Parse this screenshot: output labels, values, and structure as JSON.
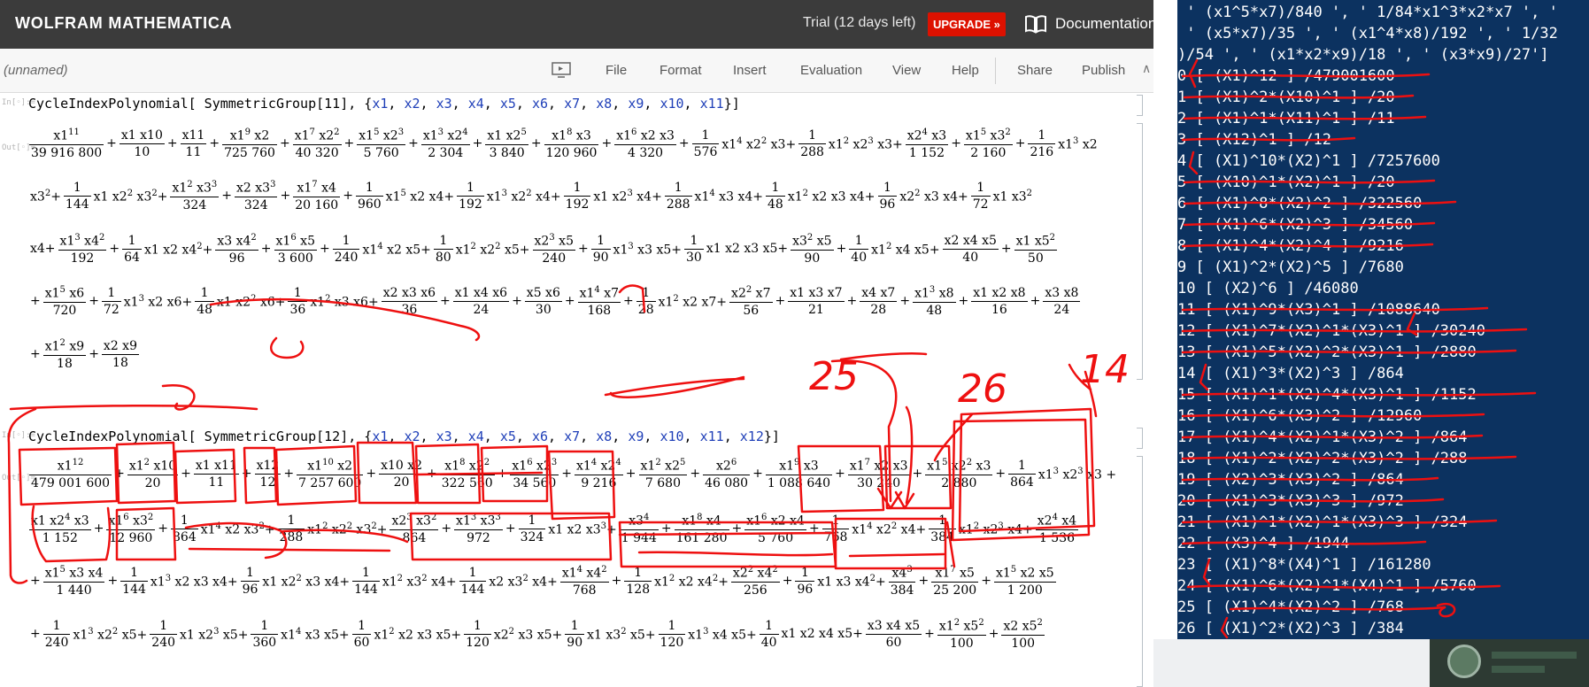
{
  "app": {
    "brand": "WOLFRAM MATHEMATICA",
    "trial": "Trial (12 days left)",
    "upgrade": "UPGRADE »",
    "documentation": "Documentation",
    "notebook_name": "(unnamed)",
    "menus": [
      "File",
      "Format",
      "Insert",
      "Evaluation",
      "View",
      "Help",
      "Share",
      "Publish"
    ],
    "cell_marker_in": "In[◦]:=",
    "cell_marker_out": "Out[◦]="
  },
  "cells": [
    {
      "input": {
        "head": "CycleIndexPolynomial[ SymmetricGroup[11], {",
        "vars": [
          "x1",
          "x2",
          "x3",
          "x4",
          "x5",
          "x6",
          "x7",
          "x8",
          "x9",
          "x10",
          "x11"
        ],
        "tail": "}]"
      },
      "lines": [
        "[x1^11|39 916 800]+[x1 x10|10]+[x11|11]+[x1^9 x2|725 760]+[x1^7 x2^2|40 320]+[x1^5 x2^3|5 760]+[x1^3 x2^4|2 304]+[x1 x2^5|3 840]+[x1^8 x3|120 960]+[x1^6 x2 x3|4 320]+[1|576] x1^4 x2^2 x3+[1|288] x1^2 x2^3 x3+[x2^4 x3|1 152]+[x1^5 x3^2|2 160]+[1|216] x1^3 x2",
        "x3^2+[1|144] x1 x2^2 x3^2+[x1^2 x3^3|324]+[x2 x3^3|324]+[x1^7 x4|20 160]+[1|960] x1^5 x2 x4+[1|192] x1^3 x2^2 x4+[1|192] x1 x2^3 x4+[1|288] x1^4 x3 x4+[1|48] x1^2 x2 x3 x4+[1|96] x2^2 x3 x4+[1|72] x1 x3^2",
        "x4+[x1^3 x4^2|192]+[1|64] x1 x2 x4^2+[x3 x4^2|96]+[x1^6 x5|3 600]+[1|240] x1^4 x2 x5+[1|80] x1^2 x2^2 x5+[x2^3 x5|240]+[1|90] x1^3 x3 x5+[1|30] x1 x2 x3 x5+[x3^2 x5|90]+[1|40] x1^2 x4 x5+[x2 x4 x5|40]+[x1 x5^2|50]",
        "+[x1^5 x6|720]+[1|72] x1^3 x2 x6+[1|48] x1 x2^2 x6+[1|36] x1^2 x3 x6+[x2 x3 x6|36]+[x1 x4 x6|24]+[x5 x6|30]+[x1^4 x7|168]+[1|28] x1^2 x2 x7+[x2^2 x7|56]+[x1 x3 x7|21]+[x4 x7|28]+[x1^3 x8|48]+[x1 x2 x8|16]+[x3 x8|24]",
        "+[x1^2 x9|18]+[x2 x9|18]"
      ]
    },
    {
      "input": {
        "head": "CycleIndexPolynomial[ SymmetricGroup[12], {",
        "vars": [
          "x1",
          "x2",
          "x3",
          "x4",
          "x5",
          "x6",
          "x7",
          "x8",
          "x9",
          "x10",
          "x11",
          "x12"
        ],
        "tail": "}]"
      },
      "lines": [
        "[x1^12|479 001 600]+[x1^2 x10|20]+[x1 x11|11]+[x12|12]+[x1^10 x2|7 257 600]+[x10 x2|20]+[x1^8 x2^2|322 560]+[x1^6 x2^3|34 560]+[x1^4 x2^4|9 216]+[x1^2 x2^5|7 680]+[x2^6|46 080]+[x1^9 x3|1 088 640]+[x1^7 x2 x3|30 240]+[x1^5 x2^2 x3|2 880]+[1|864] x1^3 x2^3 x3 +",
        "[x1 x2^4 x3|1 152]+[x1^6 x3^2|12 960]+[1|864] x1^4 x2 x3^2+[1|288] x1^2 x2^2 x3^2+[x2^3 x3^2|864]+[x1^3 x3^3|972]+[1|324] x1 x2 x3^3+[x3^4|1 944]+[x1^8 x4|161 280]+[x1^6 x2 x4|5 760]+[1|768] x1^4 x2^2 x4+[1|384] x1^2 x2^3 x4+[x2^4 x4|1 536]",
        "+[x1^5 x3 x4|1 440]+[1|144] x1^3 x2 x3 x4+[1|96] x1 x2^2 x3 x4+[1|144] x1^2 x3^2 x4+[1|144] x2 x3^2 x4+[x1^4 x4^2|768]+[1|128] x1^2 x2 x4^2+[x2^2 x4^2|256]+[1|96] x1 x3 x4^2+[x4^3|384]+[x1^7 x5|25 200]+[x1^5 x2 x5|1 200]",
        "+[1|240] x1^3 x2^2 x5+[1|240] x1 x2^3 x5+[1|360] x1^4 x3 x5+[1|60] x1^2 x2 x3 x5+[1|120] x2^2 x3 x5+[1|90] x1 x3^2 x5+[1|120] x1^3 x4 x5+[1|40] x1 x2 x4 x5+[x3 x4 x5|60]+[x1^2 x5^2|100]+[x2 x5^2|100]"
      ]
    }
  ],
  "terminal": {
    "header": [
      " ' (x1^5*x7)/840 ', ' 1/84*x1^3*x2*x7 ', '",
      " ' (x5*x7)/35 ', ' (x1^4*x8)/192 ', ' 1/32",
      ")/54 ', ' (x1*x2*x9)/18 ', ' (x3*x9)/27']"
    ],
    "rows": [
      "0 [ (X1)^12 ] /479001600",
      "1 [ (X1)^2*(X10)^1 ] /20",
      "2 [ (X1)^1*(X11)^1 ] /11",
      "3 [ (X12)^1 ] /12",
      "4 [ (X1)^10*(X2)^1 ] /7257600",
      "5 [ (X10)^1*(X2)^1 ] /20",
      "6 [ (X1)^8*(X2)^2 ] /322560",
      "7 [ (X1)^6*(X2)^3 ] /34560",
      "8 [ (X1)^4*(X2)^4 ] /9216",
      "9 [ (X1)^2*(X2)^5 ] /7680",
      "10 [ (X2)^6 ] /46080",
      "11 [ (X1)^9*(X3)^1 ] /1088640",
      "12 [ (X1)^7*(X2)^1*(X3)^1 ] /30240",
      "13 [ (X1)^5*(X2)^2*(X3)^1 ] /2880",
      "14 [ (X1)^3*(X2)^3 ] /864",
      "15 [ (X1)^1*(X2)^4*(X3)^1 ] /1152",
      "16 [ (X1)^6*(X3)^2 ] /12960",
      "17 [ (X1)^4*(X2)^1*(X3)^2 ] /864",
      "18 [ (X1)^2*(X2)^2*(X3)^2 ] /288",
      "19 [ (X2)^3*(X3)^2 ] /864",
      "20 [ (X1)^3*(X3)^3 ] /972",
      "21 [ (X1)^1*(X2)^1*(X3)^3 ] /324",
      "22 [ (X3)^4 ] /1944",
      "23 [ (X1)^8*(X4)^1 ] /161280",
      "24 [ (X1)^6*(X2)^1*(X4)^1 ] /5760",
      "25 [ (X1)^4*(X2)^2 ] /768",
      "26 [ (X1)^2*(X2)^3 ] /384"
    ]
  },
  "handwritten_notes": [
    "25",
    "26",
    "14"
  ],
  "colors": {
    "ink": "#ee1010",
    "terminal_bg": "#0c3260",
    "topbar": "#3b3b3b",
    "upgrade": "#dd1100",
    "var": "#1f3fb8"
  }
}
